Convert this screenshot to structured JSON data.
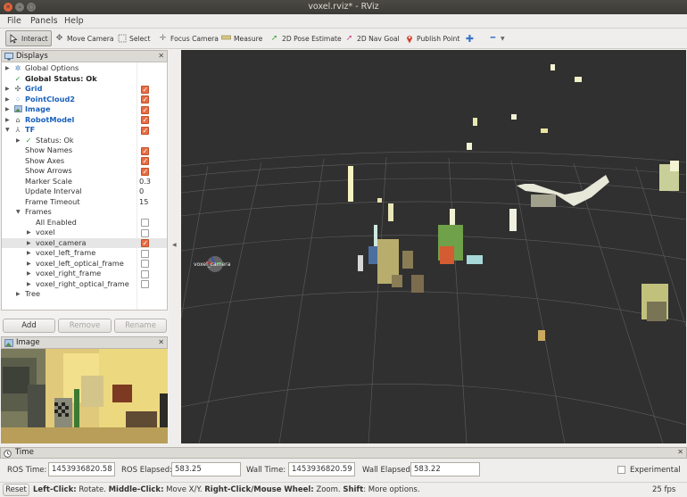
{
  "window": {
    "title": "voxel.rviz* - RViz"
  },
  "menu": [
    "File",
    "Panels",
    "Help"
  ],
  "toolbar": {
    "interact": "Interact",
    "move_camera": "Move Camera",
    "select": "Select",
    "focus_camera": "Focus Camera",
    "measure": "Measure",
    "pose_estimate": "2D Pose Estimate",
    "nav_goal": "2D Nav Goal",
    "publish_point": "Publish Point"
  },
  "displays": {
    "title": "Displays",
    "global_options": "Global Options",
    "global_status": "Global Status: Ok",
    "grid": "Grid",
    "pointcloud2": "PointCloud2",
    "image": "Image",
    "robot_model": "RobotModel",
    "tf": "TF",
    "tf_status": "Status: Ok",
    "show_names": "Show Names",
    "show_axes": "Show Axes",
    "show_arrows": "Show Arrows",
    "marker_scale": "Marker Scale",
    "marker_scale_value": "0.3",
    "update_interval": "Update Interval",
    "update_interval_value": "0",
    "frame_timeout": "Frame Timeout",
    "frame_timeout_value": "15",
    "frames": "Frames",
    "all_enabled": "All Enabled",
    "frame_items": [
      "voxel",
      "voxel_camera",
      "voxel_left_frame",
      "voxel_left_optical_frame",
      "voxel_right_frame",
      "voxel_right_optical_frame"
    ],
    "tree": "Tree",
    "add": "Add",
    "remove": "Remove",
    "rename": "Rename"
  },
  "image_panel": {
    "title": "Image"
  },
  "view": {
    "frame_label": "voxel_camera"
  },
  "time": {
    "title": "Time",
    "ros_time_label": "ROS Time:",
    "ros_time": "1453936820.58",
    "ros_elapsed_label": "ROS Elapsed:",
    "ros_elapsed": "583.25",
    "wall_time_label": "Wall Time:",
    "wall_time": "1453936820.59",
    "wall_elapsed_label": "Wall Elapsed:",
    "wall_elapsed": "583.22",
    "experimental": "Experimental"
  },
  "status": {
    "reset": "Reset",
    "left_click_key": "Left-Click:",
    "left_click_val": " Rotate. ",
    "middle_click_key": "Middle-Click:",
    "middle_click_val": " Move X/Y. ",
    "right_click_key": "Right-Click/Mouse Wheel:",
    "right_click_val": " Zoom. ",
    "shift_key": "Shift",
    "shift_val": ": More options.",
    "fps": "25 fps"
  },
  "colors": {
    "view_bg": "#303030",
    "accent_checkbox": "#e86d44",
    "link_blue": "#1960bb"
  }
}
